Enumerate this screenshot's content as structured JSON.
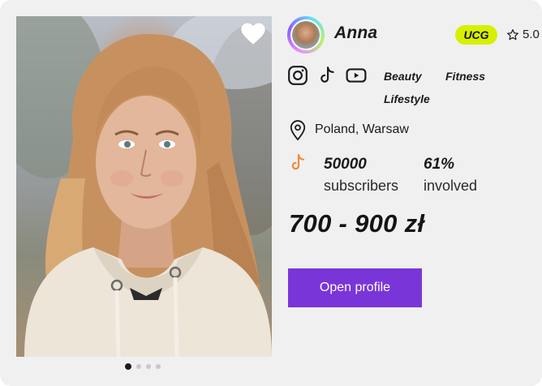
{
  "creator": {
    "name": "Anna",
    "badge": "UCG",
    "rating": "5.0",
    "tags": [
      "Beauty",
      "Fitness",
      "Lifestyle"
    ],
    "location": "Poland, Warsaw",
    "stats": [
      {
        "value": "50000",
        "label": "subscribers"
      },
      {
        "value": "61%",
        "label": "involved"
      }
    ],
    "price": "700 - 900 zł",
    "open_profile_label": "Open profile"
  },
  "gallery": {
    "total_slides": 4,
    "active_slide": 1
  },
  "icons": [
    "heart-icon",
    "instagram-icon",
    "tiktok-icon",
    "youtube-icon",
    "location-pin-icon",
    "star-icon"
  ],
  "colors": {
    "accent": "#7a35d9",
    "badge": "#d6f000",
    "tiktok_highlight": "#f08a3b",
    "card_bg": "#f0f0f1"
  }
}
